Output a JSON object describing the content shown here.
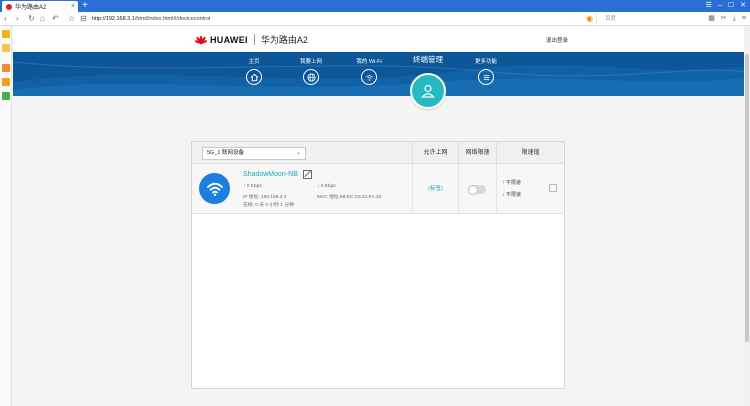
{
  "browser": {
    "tab_title": "华为路由A2",
    "url_host": "http://192.168.3.1",
    "url_path": "/html/index.html#/devicecontrol",
    "search_placeholder": "百度"
  },
  "header": {
    "brand": "HUAWEI",
    "model": "华为路由A2",
    "logout": "退出登录"
  },
  "nav": {
    "items": [
      {
        "label": "主页",
        "icon": "home-icon"
      },
      {
        "label": "我要上网",
        "icon": "globe-icon"
      },
      {
        "label": "我的 Wi-Fi",
        "icon": "wifi-icon"
      },
      {
        "label": "终端管理",
        "icon": "user-icon"
      },
      {
        "label": "更多功能",
        "icon": "menu-icon"
      }
    ]
  },
  "table": {
    "selected_filter": "5G_1 联网设备",
    "columns": {
      "allow": "允许上网",
      "limit": "网络限速",
      "rate": "限速值"
    },
    "rows": [
      {
        "name": "ShadowMoon-NB",
        "up_speed": "0 Kbps",
        "down_speed": "0 Kbps",
        "ip": "IP 地址: 192.168.3.4",
        "mac": "MAC 地址:68:EC:C5:41:FA:32",
        "online": "在线: 0 天 0 小时 1 分钟",
        "allowed": "(标签)",
        "rate_up": "不限速",
        "rate_down": "不限速"
      }
    ]
  }
}
